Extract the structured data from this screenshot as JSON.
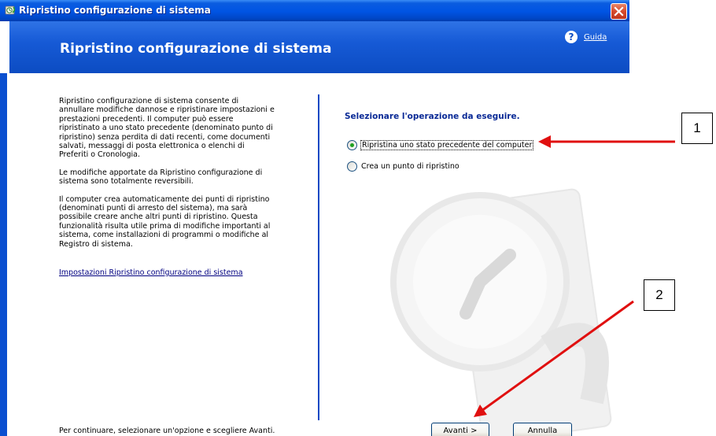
{
  "window": {
    "title": "Ripristino configurazione di sistema",
    "close_icon": "close-icon"
  },
  "header": {
    "title": "Ripristino configurazione di sistema",
    "help_label": "Guida",
    "help_icon": "help-icon"
  },
  "left_panel": {
    "paragraphs": [
      "Ripristino configurazione di sistema consente di annullare modifiche dannose e ripristinare impostazioni e prestazioni precedenti. Il computer può essere ripristinato a uno stato precedente (denominato punto di ripristino) senza perdita di dati recenti, come documenti salvati, messaggi di posta elettronica o elenchi di Preferiti o Cronologia.",
      "Le modifiche apportate da Ripristino configurazione di sistema sono totalmente reversibili.",
      "Il computer crea automaticamente dei punti di ripristino (denominati punti di arresto del sistema), ma sarà possibile creare anche altri punti di ripristino. Questa funzionalità risulta utile prima di modifiche importanti al sistema, come installazioni di programmi o modifiche al Registro di sistema."
    ],
    "settings_link": "Impostazioni Ripristino configurazione di sistema",
    "bottom_note": "Per continuare, selezionare un'opzione e scegliere Avanti."
  },
  "right_panel": {
    "prompt": "Selezionare l'operazione da eseguire.",
    "options": [
      {
        "label": "Ripristina uno stato precedente del computer",
        "selected": true
      },
      {
        "label": "Crea un punto di ripristino",
        "selected": false
      }
    ]
  },
  "buttons": {
    "next_label": "Avanti >",
    "cancel_label": "Annulla"
  },
  "callouts": {
    "one": "1",
    "two": "2"
  },
  "colors": {
    "titlebar": "#0054e3",
    "header": "#165ad6",
    "divider": "#0b48c4",
    "annotation_arrow": "#e01010",
    "radio_selected": "#21a121"
  }
}
